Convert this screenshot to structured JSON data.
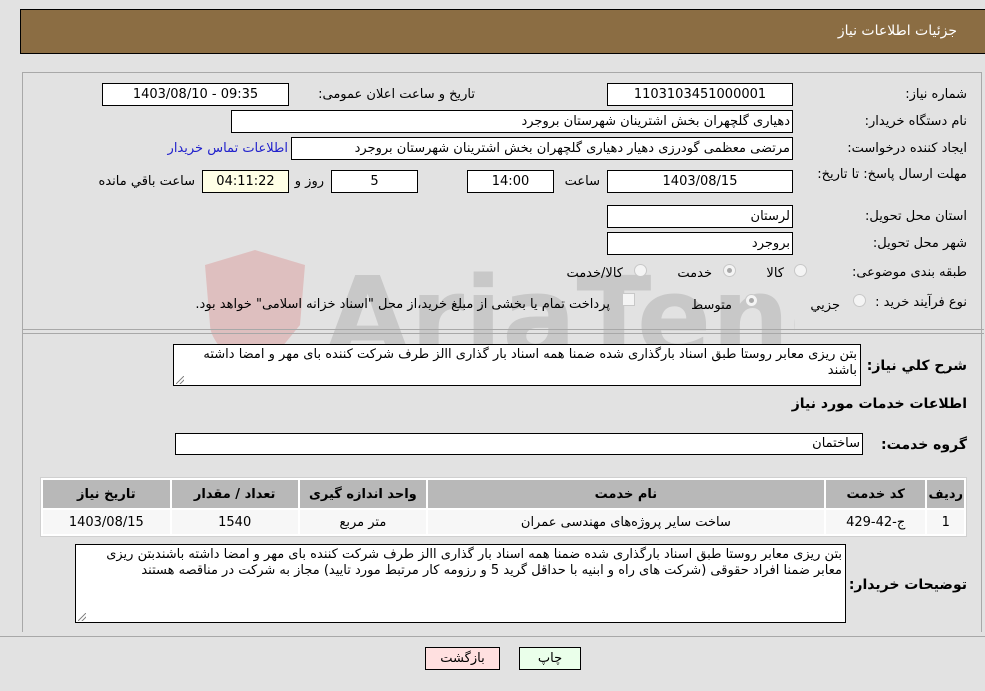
{
  "header": {
    "title": "جزئیات اطلاعات نیاز"
  },
  "form": {
    "need_number": {
      "label": "شماره نیاز:",
      "value": "1103103451000001"
    },
    "announce_datetime": {
      "label": "تاریخ و ساعت اعلان عمومی:",
      "value": "1403/08/10 - 09:35"
    },
    "buyer_org": {
      "label": "نام دستگاه خریدار:",
      "value": "دهیاری گلچهران بخش اشترینان شهرستان بروجرد"
    },
    "requester": {
      "label": "ایجاد کننده درخواست:",
      "value": "مرتضی معظمی گودرزی دهیار دهیاری گلچهران بخش اشترینان شهرستان بروجرد",
      "contact_link": "اطلاعات تماس خریدار"
    },
    "deadline": {
      "label": "مهلت ارسال پاسخ: تا تاریخ:",
      "date": "1403/08/15",
      "time_label": "ساعت",
      "time": "14:00",
      "days": "5",
      "days_label": "روز و",
      "remaining": "04:11:22",
      "remaining_label": "ساعت باقي مانده"
    },
    "province": {
      "label": "استان محل تحویل:",
      "value": "لرستان"
    },
    "city": {
      "label": "شهر محل تحویل:",
      "value": "بروجرد"
    },
    "category": {
      "label": "طبقه بندی موضوعی:",
      "options": [
        "کالا",
        "خدمت",
        "کالا/خدمت"
      ],
      "selected": "خدمت"
    },
    "purchase_type": {
      "label": "نوع فرآیند خرید :",
      "options": [
        "جزيي",
        "متوسط"
      ],
      "selected": "متوسط",
      "payment_note": "پرداخت تمام یا بخشی از مبلغ خرید،از محل \"اسناد خزانه اسلامی\" خواهد بود."
    }
  },
  "description": {
    "label": "شرح کلي نياز:",
    "value": "بتن ریزی معابر روستا طبق اسناد بارگذاری شده ضمنا همه اسناد بار گذاری االز طرف شرکت کننده بای مهر و امضا داشته باشند"
  },
  "services": {
    "section_title": "اطلاعات خدمات مورد نياز",
    "group_label": "گروه خدمت:",
    "group_value": "ساختمان",
    "columns": [
      "ردیف",
      "کد خدمت",
      "نام خدمت",
      "واحد اندازه گیری",
      "تعداد / مقدار",
      "تاریخ نیاز"
    ],
    "rows": [
      {
        "row": "1",
        "code": "ج-42-429",
        "name": "ساخت سایر پروژه‌های مهندسی عمران",
        "unit": "متر مربع",
        "qty": "1540",
        "date": "1403/08/15"
      }
    ]
  },
  "buyer_notes": {
    "label": "توضیحات خریدار:",
    "value": "بتن ریزی معابر روستا طبق اسناد بارگذاری شده ضمنا همه اسناد بار گذاری االز طرف شرکت کننده بای مهر و امضا داشته باشندبتن ریزی معابر ضمنا  افراد حقوقی (شرکت های راه  و ابنیه با حداقل گرید 5 و رزومه کار مرتبط مورد تایید) مجاز به شرکت در مناقصه هستند"
  },
  "buttons": {
    "print": "چاپ",
    "back": "بازگشت"
  },
  "colors": {
    "header_bg": "#8b6d43",
    "print_bg": "#eaffea",
    "back_bg": "#ffe0e0",
    "link": "#2222cc"
  }
}
